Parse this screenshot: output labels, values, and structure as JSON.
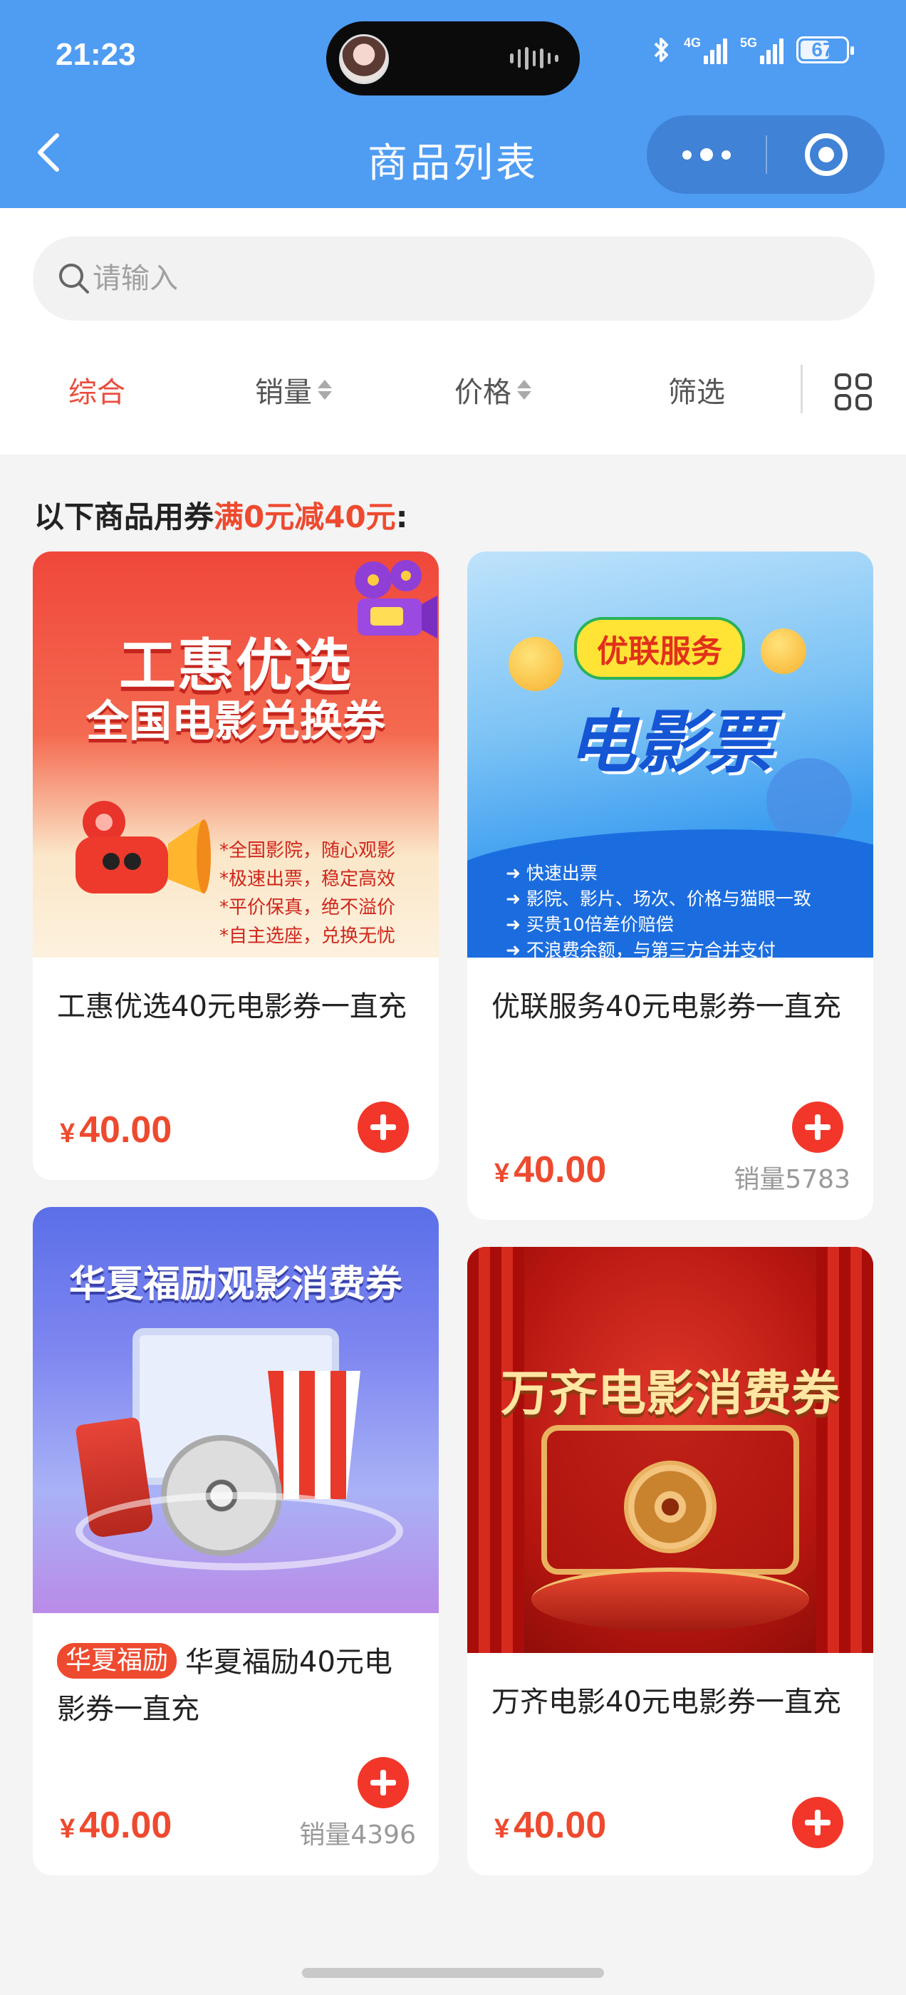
{
  "status_bar": {
    "time": "21:23",
    "network_1": "4G",
    "network_2": "5G",
    "battery": "67",
    "battery_level": 0.67
  },
  "nav": {
    "title": "商品列表",
    "back_icon": "chevron-left-icon",
    "more_icon": "more-dots-icon",
    "close_icon": "target-circle-icon"
  },
  "search": {
    "placeholder": "请输入",
    "value": ""
  },
  "filters": {
    "items": [
      "综合",
      "销量",
      "价格",
      "筛选"
    ],
    "active": "综合",
    "layout_icon": "grid-view-icon"
  },
  "coupon_note": {
    "prefix": "以下商品用券",
    "highlight": "满0元减40元",
    "suffix": ":"
  },
  "colors": {
    "header": "#4f9cf3",
    "accent": "#ee4a2f",
    "add_button": "#f2372a"
  },
  "products": [
    {
      "name": "工惠优选40元电影券一直充",
      "tag": "",
      "price_currency": "¥",
      "price": "40.00",
      "sales": "",
      "image": {
        "title_line1": "工惠优选",
        "title_line2": "全国电影兑换券",
        "bullets": [
          "*全国影院，随心观影",
          "*极速出票，稳定高效",
          "*平价保真，绝不溢价",
          "*自主选座，兑换无忧"
        ]
      }
    },
    {
      "name": "优联服务40元电影券一直充",
      "tag": "",
      "price_currency": "¥",
      "price": "40.00",
      "sales": "销量5783",
      "image": {
        "badge": "优联服务",
        "title": "电影票",
        "bullets": [
          "➜ 快速出票",
          "➜ 影院、影片、场次、价格与猫眼一致",
          "➜ 买贵10倍差价赔偿",
          "➜ 不浪费余额，与第三方合并支付"
        ]
      }
    },
    {
      "name": "华夏福励40元电影券一直充",
      "tag": "华夏福励",
      "price_currency": "¥",
      "price": "40.00",
      "sales": "销量4396",
      "image": {
        "title": "华夏福励观影消费券"
      }
    },
    {
      "name": "万齐电影40元电影券一直充",
      "tag": "",
      "price_currency": "¥",
      "price": "40.00",
      "sales": "",
      "image": {
        "title": "万齐电影消费券"
      }
    }
  ]
}
